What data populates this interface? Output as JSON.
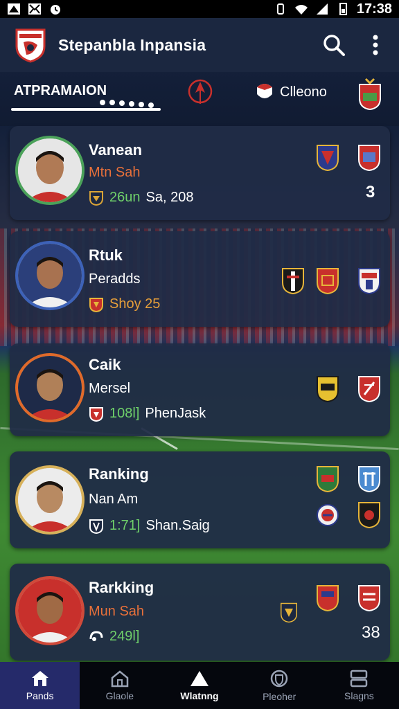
{
  "status_bar": {
    "time": "17:38"
  },
  "app": {
    "title": "Stepanbla Inpansia"
  },
  "tabs": {
    "active_label": "ATPRAMAION",
    "second_label": "Clleono"
  },
  "cards": [
    {
      "name": "Vanean",
      "subtitle": "Mtn Sah",
      "meta_num": "26un",
      "meta_text": "Sa, 208",
      "rank": "3"
    },
    {
      "name": "Rtuk",
      "subtitle": "Peradds",
      "meta_num": "Shoy 25",
      "meta_text": "",
      "rank": ""
    },
    {
      "name": "Caik",
      "subtitle": "Mersel",
      "meta_num": "108l]",
      "meta_text": "PhenJask",
      "rank": ""
    },
    {
      "name": "Ranking",
      "subtitle": "Nan Am",
      "meta_num": "1:71]",
      "meta_text": "Shan.Saig",
      "rank": ""
    },
    {
      "name": "Rarkking",
      "subtitle": "Mun Sah",
      "meta_num": "249l]",
      "meta_text": "",
      "rank": "38"
    }
  ],
  "bottom_nav": [
    {
      "label": "Pands",
      "icon": "home-icon"
    },
    {
      "label": "Glaole",
      "icon": "house-outline-icon"
    },
    {
      "label": "Wlatnng",
      "icon": "triangle-icon"
    },
    {
      "label": "Pleoher",
      "icon": "shield-icon"
    },
    {
      "label": "Slagns",
      "icon": "layers-icon"
    }
  ],
  "colors": {
    "appbar": "#1b2740",
    "card": "#202c46",
    "accent_green": "#6fd06a",
    "accent_orange": "#e8703a",
    "nav_active": "#252a6a"
  }
}
